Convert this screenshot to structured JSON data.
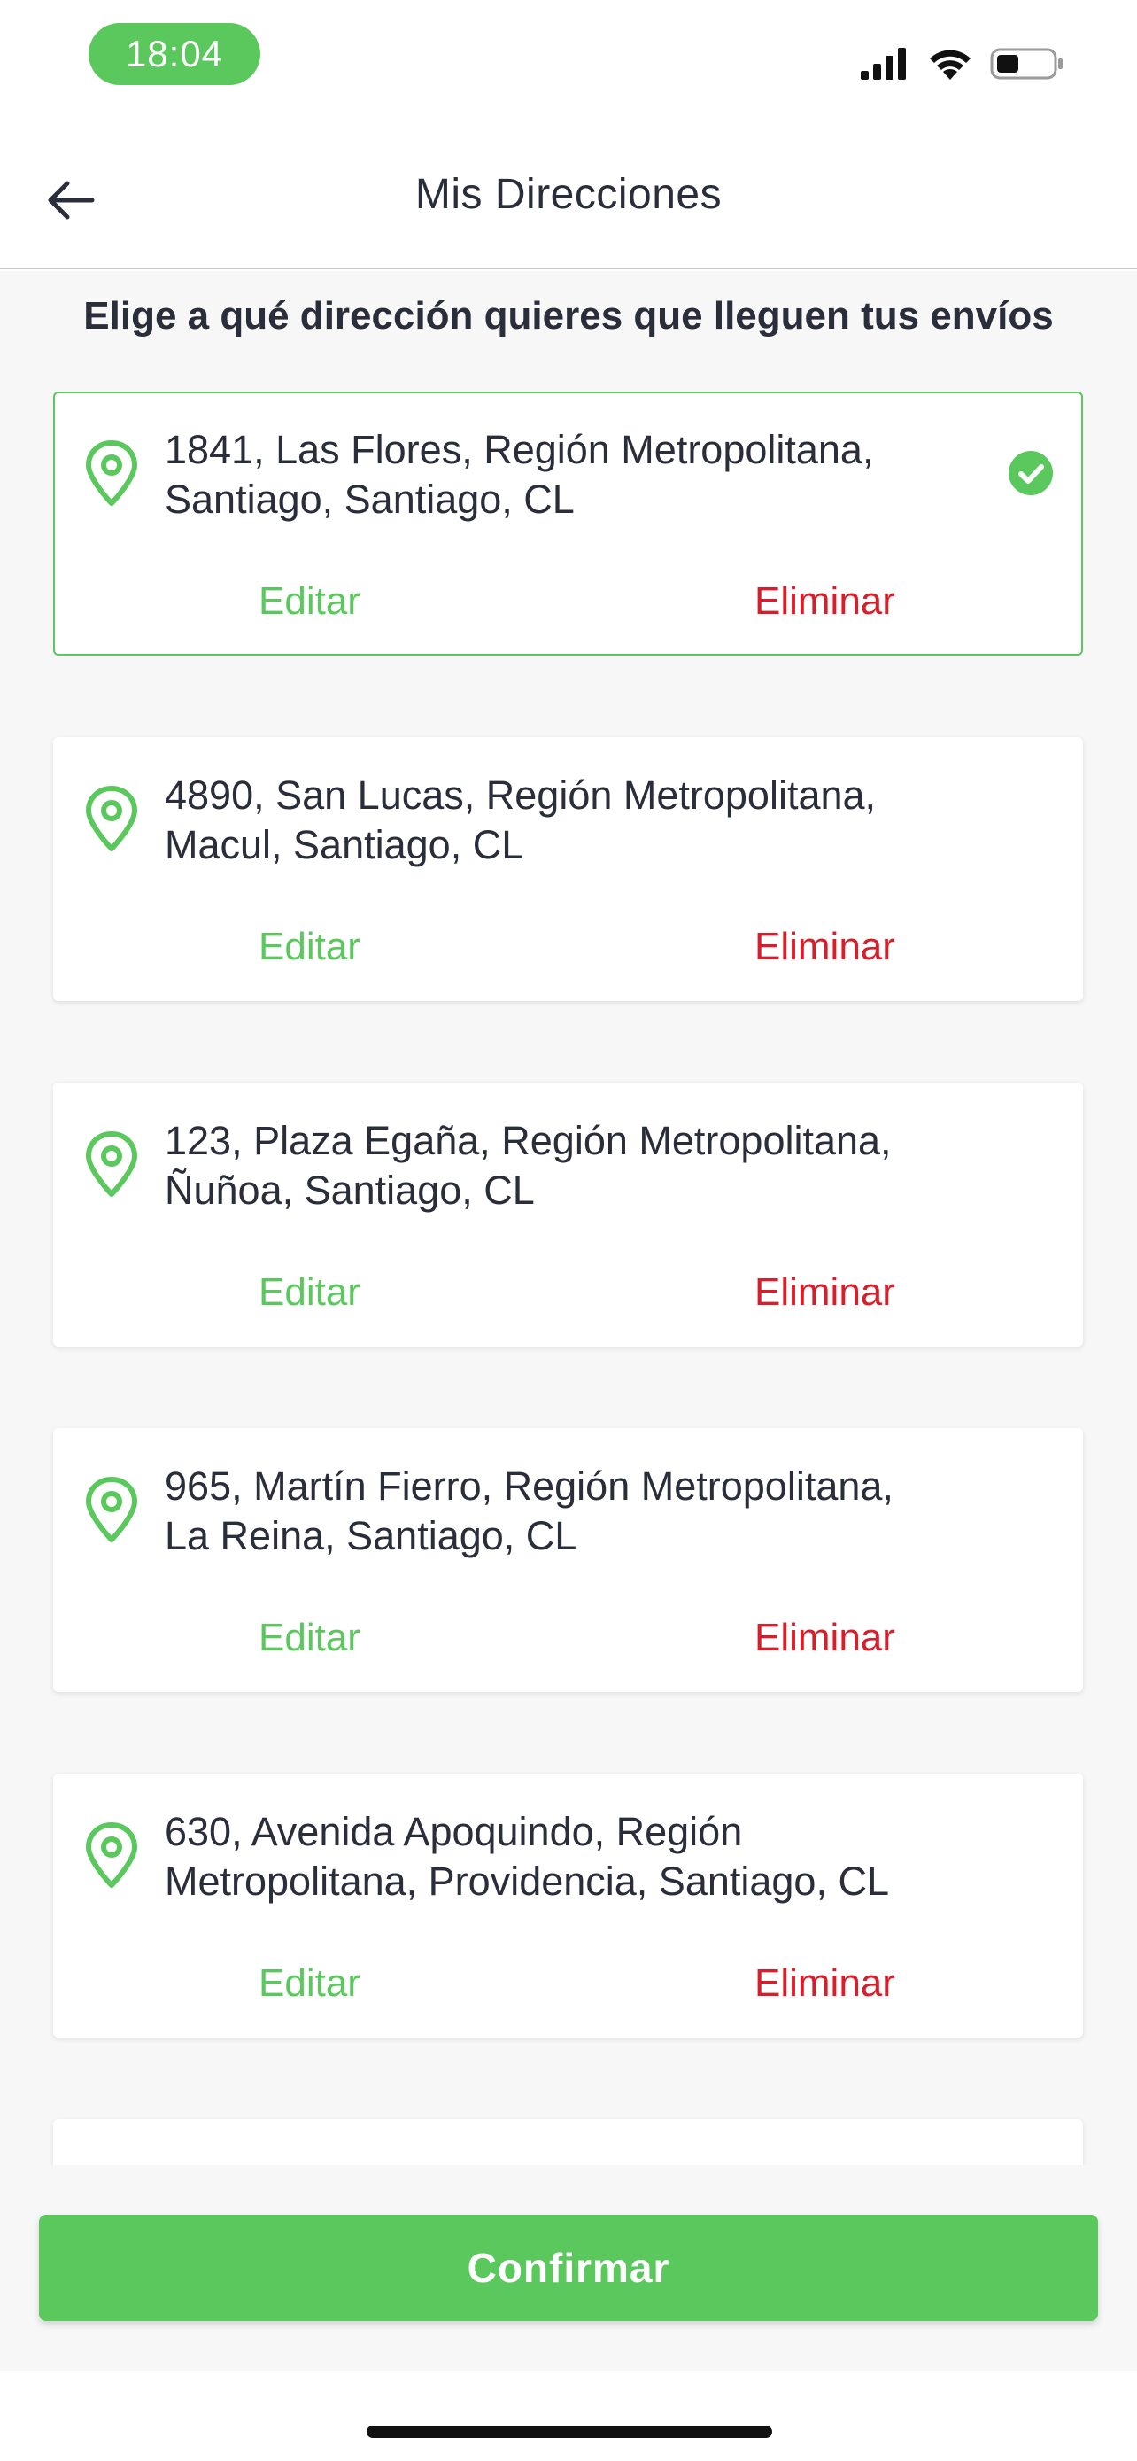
{
  "status_bar": {
    "time": "18:04"
  },
  "header": {
    "title": "Mis Direcciones",
    "back_icon": "arrow-left-icon"
  },
  "instruction": "Elige a qué dirección quieres que lleguen tus envíos",
  "addresses": [
    {
      "line1": "1841, Las Flores, Región Metropolitana,",
      "line2": "Santiago, Santiago, CL",
      "selected": true,
      "edit_label": "Editar",
      "delete_label": "Eliminar"
    },
    {
      "line1": "4890, San Lucas, Región Metropolitana,",
      "line2": "Macul, Santiago, CL",
      "selected": false,
      "edit_label": "Editar",
      "delete_label": "Eliminar"
    },
    {
      "line1": "123, Plaza Egaña, Región Metropolitana,",
      "line2": "Ñuñoa, Santiago, CL",
      "selected": false,
      "edit_label": "Editar",
      "delete_label": "Eliminar"
    },
    {
      "line1": "965, Martín Fierro, Región Metropolitana,",
      "line2": "La Reina, Santiago, CL",
      "selected": false,
      "edit_label": "Editar",
      "delete_label": "Eliminar"
    },
    {
      "line1": "630, Avenida Apoquindo, Región",
      "line2": "Metropolitana, Providencia, Santiago, CL",
      "selected": false,
      "edit_label": "Editar",
      "delete_label": "Eliminar"
    }
  ],
  "confirm_label": "Confirmar",
  "colors": {
    "accent": "#5ac85c",
    "danger": "#d91e2b",
    "text": "#2a2d3a",
    "background": "#f7f7f8"
  }
}
